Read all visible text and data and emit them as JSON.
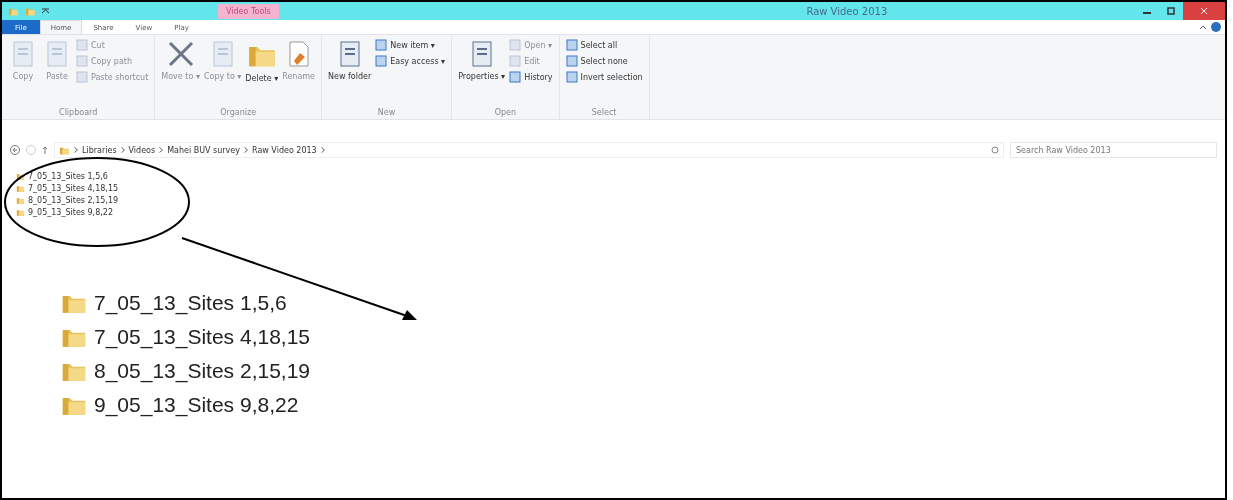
{
  "window": {
    "title": "Raw Video 2013",
    "context_tab": "Video Tools"
  },
  "tabs": [
    {
      "label": "File",
      "kind": "file",
      "selected": false
    },
    {
      "label": "Home",
      "kind": "tab",
      "selected": true
    },
    {
      "label": "Share",
      "kind": "tab",
      "selected": false
    },
    {
      "label": "View",
      "kind": "tab",
      "selected": false
    },
    {
      "label": "Play",
      "kind": "tab",
      "selected": false
    }
  ],
  "ribbon": [
    {
      "label": "Clipboard",
      "buttons": [
        {
          "label": "Copy",
          "kind": "large",
          "disabled": true
        },
        {
          "label": "Paste",
          "kind": "large",
          "disabled": true
        },
        {
          "label": "Cut",
          "kind": "small",
          "disabled": true
        },
        {
          "label": "Copy path",
          "kind": "small",
          "disabled": true
        },
        {
          "label": "Paste shortcut",
          "kind": "small",
          "disabled": true
        }
      ]
    },
    {
      "label": "Organize",
      "buttons": [
        {
          "label": "Move to ▾",
          "kind": "large",
          "disabled": true
        },
        {
          "label": "Copy to ▾",
          "kind": "large",
          "disabled": true
        },
        {
          "label": "Delete ▾",
          "kind": "large",
          "disabled": false
        },
        {
          "label": "Rename",
          "kind": "large",
          "disabled": true
        }
      ]
    },
    {
      "label": "New",
      "buttons": [
        {
          "label": "New folder",
          "kind": "large",
          "disabled": false
        },
        {
          "label": "New item ▾",
          "kind": "small",
          "disabled": false
        },
        {
          "label": "Easy access ▾",
          "kind": "small",
          "disabled": false
        }
      ]
    },
    {
      "label": "Open",
      "buttons": [
        {
          "label": "Properties ▾",
          "kind": "large",
          "disabled": false
        },
        {
          "label": "Open ▾",
          "kind": "small",
          "disabled": true
        },
        {
          "label": "Edit",
          "kind": "small",
          "disabled": true
        },
        {
          "label": "History",
          "kind": "small",
          "disabled": false
        }
      ]
    },
    {
      "label": "Select",
      "buttons": [
        {
          "label": "Select all",
          "kind": "small",
          "disabled": false
        },
        {
          "label": "Select none",
          "kind": "small",
          "disabled": false
        },
        {
          "label": "Invert selection",
          "kind": "small",
          "disabled": false
        }
      ]
    }
  ],
  "address": {
    "path": [
      "Libraries",
      "Videos",
      "Mahei BUV survey",
      "Raw Video 2013"
    ]
  },
  "search": {
    "placeholder": "Search Raw Video 2013"
  },
  "folders": [
    "7_05_13_Sites 1,5,6",
    "7_05_13_Sites 4,18,15",
    "8_05_13_Sites 2,15,19",
    "9_05_13_Sites 9,8,22"
  ],
  "zoomed_folders": [
    "7_05_13_Sites 1,5,6",
    "7_05_13_Sites 4,18,15",
    "8_05_13_Sites 2,15,19",
    "9_05_13_Sites 9,8,22"
  ]
}
